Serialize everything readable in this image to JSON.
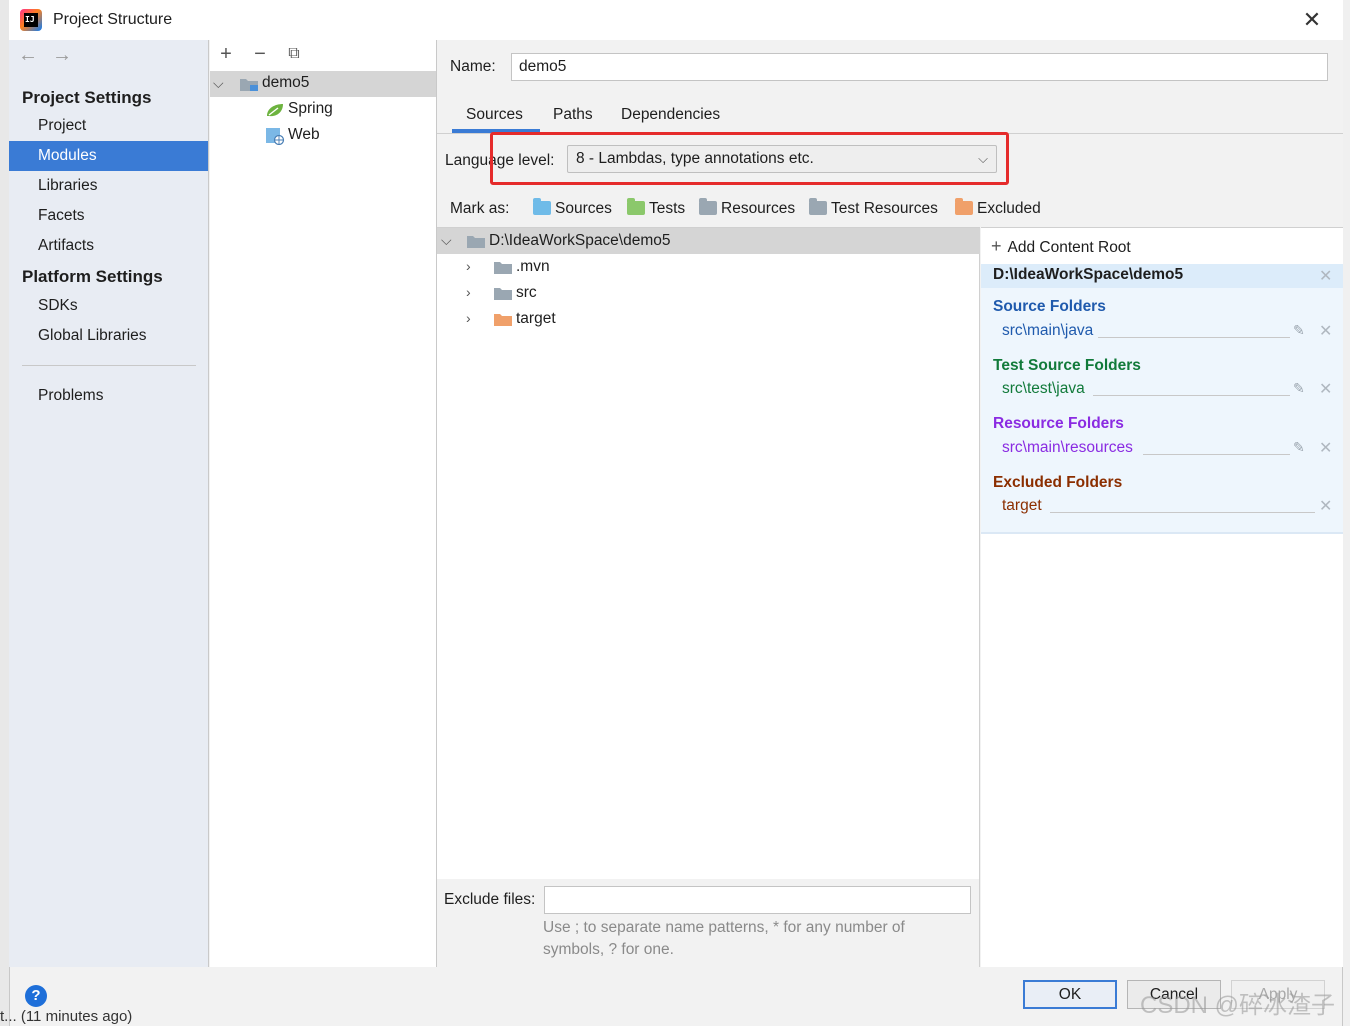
{
  "window": {
    "title": "Project Structure"
  },
  "sidebar": {
    "project_settings_header": "Project Settings",
    "items_ps": [
      {
        "label": "Project"
      },
      {
        "label": "Modules"
      },
      {
        "label": "Libraries"
      },
      {
        "label": "Facets"
      },
      {
        "label": "Artifacts"
      }
    ],
    "platform_settings_header": "Platform Settings",
    "items_plat": [
      {
        "label": "SDKs"
      },
      {
        "label": "Global Libraries"
      }
    ],
    "problems_label": "Problems",
    "selected": "Modules"
  },
  "module_tree": {
    "module": "demo5",
    "facets": [
      {
        "label": "Spring"
      },
      {
        "label": "Web"
      }
    ]
  },
  "module": {
    "name_label": "Name:",
    "name_value": "demo5",
    "tabs": [
      {
        "label": "Sources"
      },
      {
        "label": "Paths"
      },
      {
        "label": "Dependencies"
      }
    ],
    "active_tab": "Sources",
    "language_level_label": "Language level:",
    "language_level_value": "8 - Lambdas, type annotations etc.",
    "mark_as_label": "Mark as:",
    "mark_as": [
      {
        "label": "Sources",
        "color": "#6fbbe8"
      },
      {
        "label": "Tests",
        "color": "#8bc86b"
      },
      {
        "label": "Resources",
        "color": "#9aa7b2"
      },
      {
        "label": "Test Resources",
        "color": "#9aa7b2"
      },
      {
        "label": "Excluded",
        "color": "#f0a06a"
      }
    ]
  },
  "content_tree": {
    "root": "D:\\IdeaWorkSpace\\demo5",
    "children": [
      {
        "label": ".mvn"
      },
      {
        "label": "src"
      },
      {
        "label": "target"
      }
    ]
  },
  "exclude": {
    "label": "Exclude files:",
    "value": "",
    "hint_line1": "Use ; to separate name patterns, * for any number of",
    "hint_line2": "symbols, ? for one."
  },
  "content_roots": {
    "add_label": "Add Content Root",
    "root_path": "D:\\IdeaWorkSpace\\demo5",
    "source_folders_title": "Source Folders",
    "source_folder": "src\\main\\java",
    "test_folders_title": "Test Source Folders",
    "test_folder": "src\\test\\java",
    "resource_folders_title": "Resource Folders",
    "resource_folder": "src\\main\\resources",
    "excluded_folders_title": "Excluded Folders",
    "excluded_folder": "target",
    "colors": {
      "source": "#1f5aad",
      "test": "#117a3a",
      "resource": "#8a2be2",
      "excluded": "#8b2e00"
    }
  },
  "buttons": {
    "ok": "OK",
    "cancel": "Cancel",
    "apply": "Apply",
    "help": "?"
  },
  "watermark": "CSDN @碎冰渣子",
  "background_status": "t... (11 minutes ago)"
}
